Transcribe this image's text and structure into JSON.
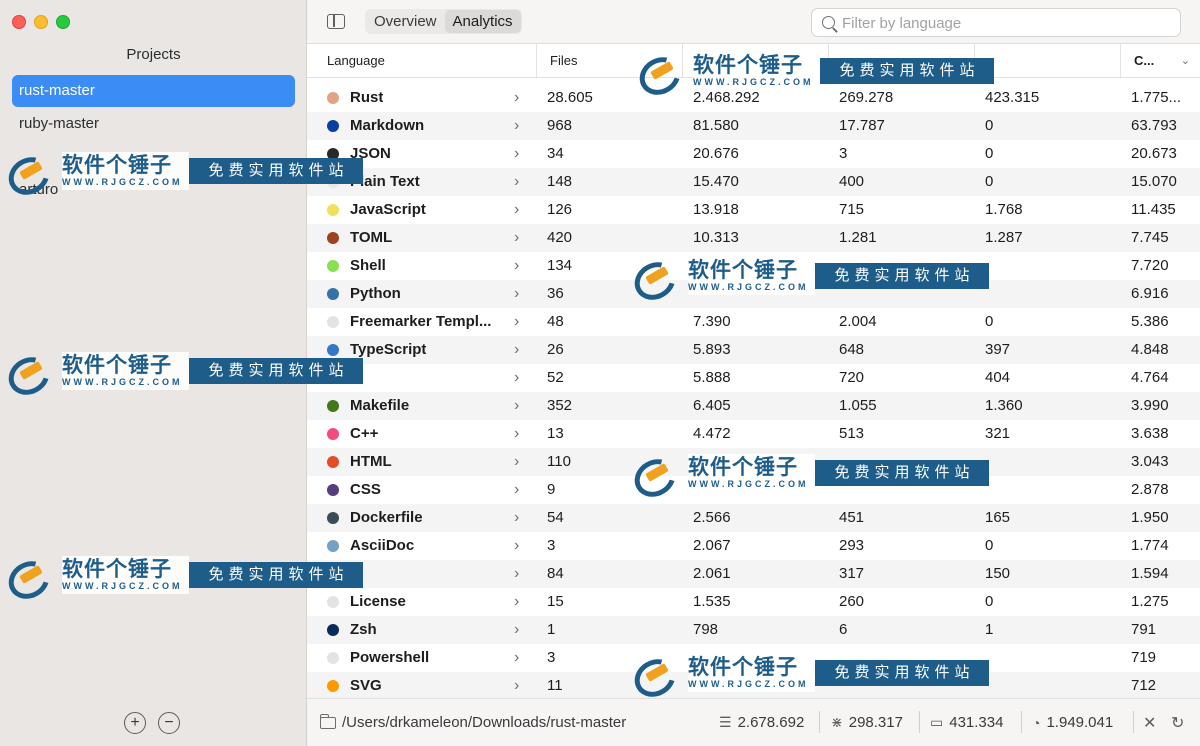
{
  "sidebar": {
    "title": "Projects",
    "projects": [
      "rust-master",
      "ruby-master",
      "",
      "arturo"
    ],
    "selected_index": 0,
    "add_label": "+",
    "remove_label": "−"
  },
  "toolbar": {
    "tabs": [
      "Overview",
      "Analytics"
    ],
    "active_tab": "Analytics",
    "search_placeholder": "Filter by language"
  },
  "table": {
    "columns": [
      "Language",
      "Files",
      "",
      "",
      "",
      "C..."
    ],
    "rows": [
      {
        "lang": "Rust",
        "color": "#dea584",
        "files": "28.605",
        "lines": "2.468.292",
        "blanks": "269.278",
        "comments": "423.315",
        "code": "1.775..."
      },
      {
        "lang": "Markdown",
        "color": "#083fa1",
        "files": "968",
        "lines": "81.580",
        "blanks": "17.787",
        "comments": "0",
        "code": "63.793"
      },
      {
        "lang": "JSON",
        "color": "#292929",
        "files": "34",
        "lines": "20.676",
        "blanks": "3",
        "comments": "0",
        "code": "20.673"
      },
      {
        "lang": "Plain Text",
        "color": "#e8e8e8",
        "files": "148",
        "lines": "15.470",
        "blanks": "400",
        "comments": "0",
        "code": "15.070"
      },
      {
        "lang": "JavaScript",
        "color": "#f1e05a",
        "files": "126",
        "lines": "13.918",
        "blanks": "715",
        "comments": "1.768",
        "code": "11.435"
      },
      {
        "lang": "TOML",
        "color": "#9c4221",
        "files": "420",
        "lines": "10.313",
        "blanks": "1.281",
        "comments": "1.287",
        "code": "7.745"
      },
      {
        "lang": "Shell",
        "color": "#89e051",
        "files": "134",
        "lines": "",
        "blanks": "",
        "comments": "",
        "code": "7.720"
      },
      {
        "lang": "Python",
        "color": "#3572a5",
        "files": "36",
        "lines": "",
        "blanks": "",
        "comments": "",
        "code": "6.916"
      },
      {
        "lang": "Freemarker Templ...",
        "color": "#e3e3e3",
        "files": "48",
        "lines": "7.390",
        "blanks": "2.004",
        "comments": "0",
        "code": "5.386"
      },
      {
        "lang": "TypeScript",
        "color": "#3178c6",
        "files": "26",
        "lines": "5.893",
        "blanks": "648",
        "comments": "397",
        "code": "4.848"
      },
      {
        "lang": "",
        "color": "#e3e3e3",
        "files": "52",
        "lines": "5.888",
        "blanks": "720",
        "comments": "404",
        "code": "4.764"
      },
      {
        "lang": "Makefile",
        "color": "#427819",
        "files": "352",
        "lines": "6.405",
        "blanks": "1.055",
        "comments": "1.360",
        "code": "3.990"
      },
      {
        "lang": "C++",
        "color": "#f34b7d",
        "files": "13",
        "lines": "4.472",
        "blanks": "513",
        "comments": "321",
        "code": "3.638"
      },
      {
        "lang": "HTML",
        "color": "#e34c26",
        "files": "110",
        "lines": "",
        "blanks": "",
        "comments": "",
        "code": "3.043"
      },
      {
        "lang": "CSS",
        "color": "#563d7c",
        "files": "9",
        "lines": "",
        "blanks": "",
        "comments": "",
        "code": "2.878"
      },
      {
        "lang": "Dockerfile",
        "color": "#384d54",
        "files": "54",
        "lines": "2.566",
        "blanks": "451",
        "comments": "165",
        "code": "1.950"
      },
      {
        "lang": "AsciiDoc",
        "color": "#73a0c5",
        "files": "3",
        "lines": "2.067",
        "blanks": "293",
        "comments": "0",
        "code": "1.774"
      },
      {
        "lang": "",
        "color": "#e3e3e3",
        "files": "84",
        "lines": "2.061",
        "blanks": "317",
        "comments": "150",
        "code": "1.594"
      },
      {
        "lang": "License",
        "color": "#e3e3e3",
        "files": "15",
        "lines": "1.535",
        "blanks": "260",
        "comments": "0",
        "code": "1.275"
      },
      {
        "lang": "Zsh",
        "color": "#0a2a5c",
        "files": "1",
        "lines": "798",
        "blanks": "6",
        "comments": "1",
        "code": "791"
      },
      {
        "lang": "Powershell",
        "color": "#e3e3e3",
        "files": "3",
        "lines": "",
        "blanks": "",
        "comments": "",
        "code": "719"
      },
      {
        "lang": "SVG",
        "color": "#ff9900",
        "files": "11",
        "lines": "",
        "blanks": "",
        "comments": "",
        "code": "712"
      }
    ]
  },
  "status": {
    "path": "/Users/drkameleon/Downloads/rust-master",
    "lines": "2.678.692",
    "blanks": "298.317",
    "comments": "431.334",
    "code": "1.949.041"
  },
  "watermark": {
    "name": "软件个锤子",
    "url": "WWW.RJGCZ.COM",
    "tagline": "免费实用软件站"
  }
}
